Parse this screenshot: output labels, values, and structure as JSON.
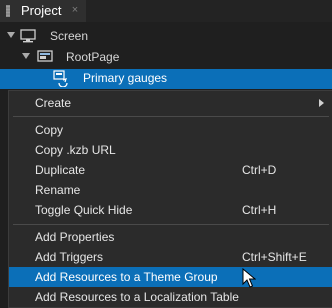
{
  "panel": {
    "tab_label": "Project",
    "close_glyph": "×"
  },
  "tree": {
    "items": [
      {
        "label": "Screen",
        "icon": "screen-icon"
      },
      {
        "label": "RootPage",
        "icon": "page-icon"
      },
      {
        "label": "Primary gauges",
        "icon": "prefab-link-icon",
        "selected": true
      }
    ]
  },
  "menu": {
    "items": [
      {
        "label": "Create",
        "has_submenu": true
      },
      {
        "label": "Copy"
      },
      {
        "label": "Copy .kzb URL"
      },
      {
        "label": "Duplicate",
        "shortcut": "Ctrl+D"
      },
      {
        "label": "Rename"
      },
      {
        "label": "Toggle Quick Hide",
        "shortcut": "Ctrl+H"
      },
      {
        "label": "Add Properties"
      },
      {
        "label": "Add Triggers",
        "shortcut": "Ctrl+Shift+E"
      },
      {
        "label": "Add Resources to a Theme Group",
        "highlighted": true
      },
      {
        "label": "Add Resources to a Localization Table"
      }
    ]
  },
  "colors": {
    "accent": "#0b6fb8",
    "menu_bg": "#2b2b2b",
    "panel_bg": "#1f1f1f"
  }
}
